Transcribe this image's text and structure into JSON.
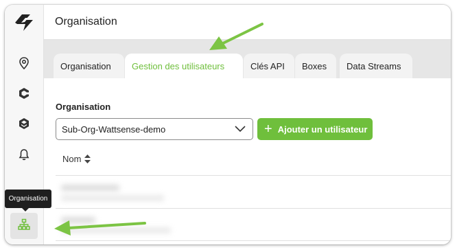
{
  "header": {
    "title": "Organisation"
  },
  "sidebar": {
    "tooltip": "Organisation",
    "icons": [
      "logo-icon",
      "location-pin-icon",
      "device-icon",
      "hub-icon",
      "bell-icon",
      "org-chart-icon"
    ]
  },
  "tabs": [
    {
      "label": "Organisation",
      "active": false
    },
    {
      "label": "Gestion des utilisateurs",
      "active": true
    },
    {
      "label": "Clés API",
      "active": false
    },
    {
      "label": "Boxes",
      "active": false
    },
    {
      "label": "Data Streams",
      "active": false
    }
  ],
  "main": {
    "org_label": "Organisation",
    "org_select_value": "Sub-Org-Wattsense-demo",
    "add_user_label": "Ajouter un utilisateur",
    "table": {
      "column_name": "Nom"
    }
  },
  "colors": {
    "accent": "#6fbf3c",
    "annotation_arrow": "#7cc444",
    "tooltip_bg": "#1f1f1f"
  }
}
